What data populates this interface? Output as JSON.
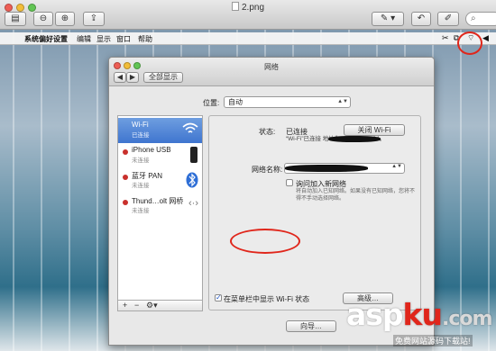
{
  "preview": {
    "doc_title": "2.png",
    "toolbar_icons": [
      "sidebar-toggle-icon",
      "zoom-out-icon",
      "zoom-in-icon",
      "share-icon",
      "annotate-icon",
      "rotate-icon",
      "edit-icon",
      "search-icon"
    ]
  },
  "menubar": {
    "items": [
      "系统偏好设置",
      "编辑",
      "显示",
      "窗口",
      "帮助"
    ]
  },
  "network": {
    "window_title": "网络",
    "show_all": "全部显示",
    "location_label": "位置:",
    "location_value": "自动",
    "services": [
      {
        "name": "Wi-Fi",
        "status": "已连接",
        "icon": "wifi-icon"
      },
      {
        "name": "iPhone USB",
        "status": "未连接",
        "icon": "iphone-icon"
      },
      {
        "name": "蓝牙 PAN",
        "status": "未连接",
        "icon": "bluetooth-icon"
      },
      {
        "name": "Thund…olt 网桥",
        "status": "未连接",
        "icon": "thunderbolt-bridge-icon"
      }
    ],
    "status_label": "状态:",
    "status_value": "已连接",
    "turn_off_button": "关闭 Wi-Fi",
    "status_note": "“Wi-Fi”已连接                              地址为 192.168.1.104。",
    "network_name_label": "网络名称:",
    "ask_join_label": "询问加入新网络",
    "ask_join_note": "将自动加入已知网络。如果没有已知网络，您将不得不手动选择网络。",
    "show_status_label": "在菜单栏中显示 Wi-Fi 状态",
    "advanced_button": "高级…",
    "assist_button": "向导…"
  },
  "watermark": {
    "asp": "asp",
    "ku": "ku",
    "com": ".com",
    "sub": "免费网站源码下载站!"
  }
}
